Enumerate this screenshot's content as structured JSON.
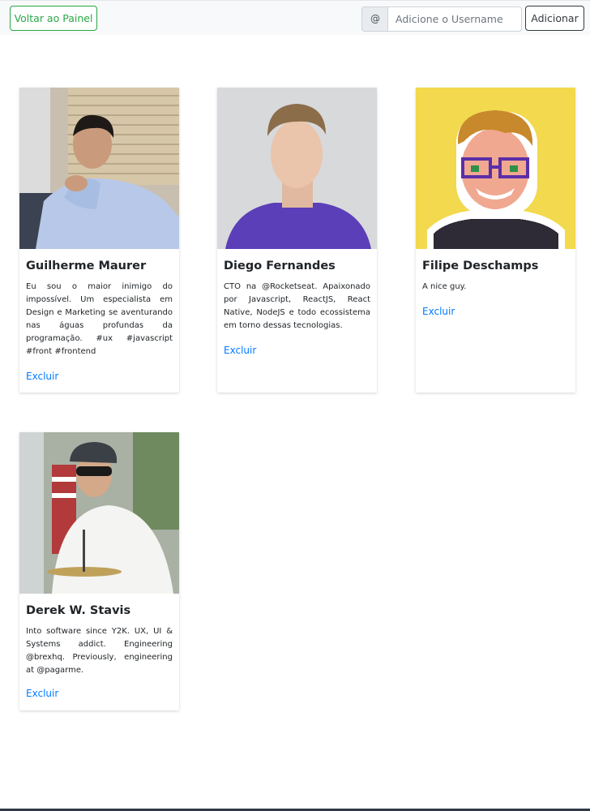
{
  "toolbar": {
    "back_label": "Voltar ao Painel",
    "at_symbol": "@",
    "username_placeholder": "Adicione o Username",
    "username_value": "",
    "add_label": "Adicionar"
  },
  "cards": [
    {
      "name": "Guilherme Maurer",
      "bio": "Eu sou o maior inimigo do impossível. Um especialista em Design e Marketing se aventurando nas águas profundas da programação. #ux #javascript #front #frontend",
      "delete_label": "Excluir"
    },
    {
      "name": "Diego Fernandes",
      "bio": "CTO na @Rocketseat. Apaixonado por Javascript, ReactJS, React Native, NodeJS e todo ecossistema em torno dessas tecnologias.",
      "delete_label": "Excluir"
    },
    {
      "name": "Filipe Deschamps",
      "bio": "A nice guy.",
      "delete_label": "Excluir"
    },
    {
      "name": "Derek W. Stavis",
      "bio": "Into software since Y2K. UX, UI & Systems addict. Engineering @brexhq. Previously, engineering at @pagarme.",
      "delete_label": "Excluir"
    }
  ],
  "colors": {
    "success": "#28a745",
    "link": "#007bff",
    "dark": "#343a40",
    "toolbar_bg": "#f8f9fa"
  }
}
